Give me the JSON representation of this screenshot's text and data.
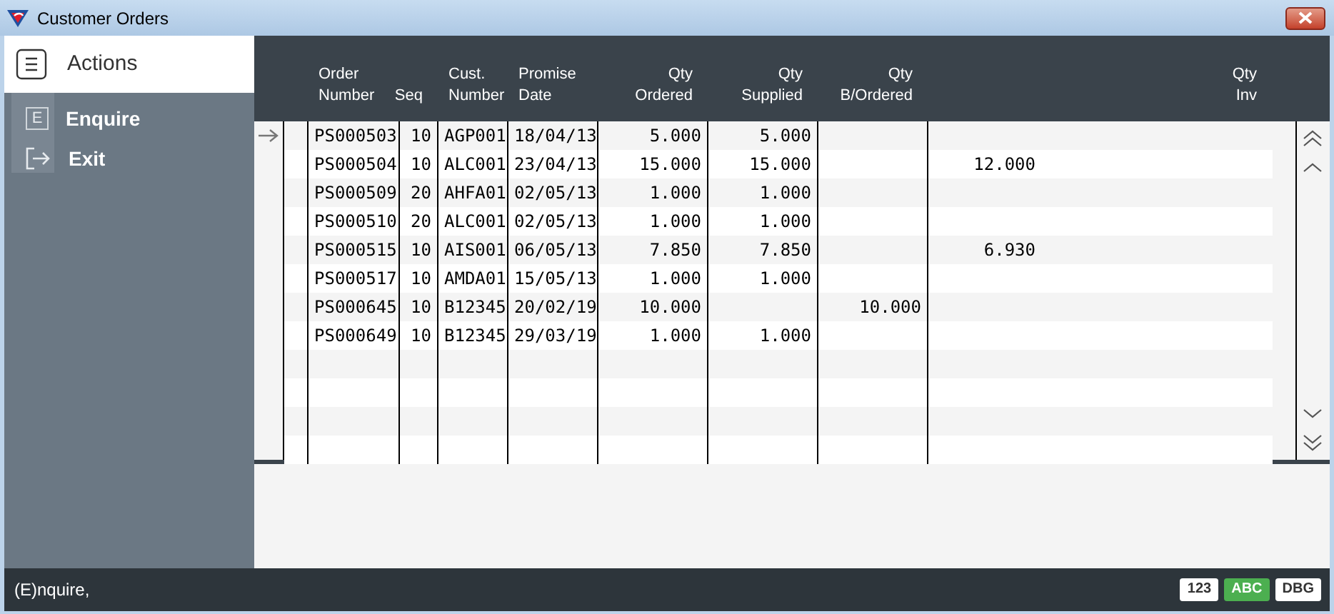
{
  "window": {
    "title": "Customer Orders"
  },
  "sidebar": {
    "title": "Actions",
    "items": [
      {
        "key": "E",
        "label": "Enquire",
        "kind": "key"
      },
      {
        "label": "Exit",
        "kind": "exit"
      }
    ]
  },
  "table": {
    "columns": [
      {
        "label": "Order\nNumber"
      },
      {
        "label": "Seq"
      },
      {
        "label": "Cust.\nNumber"
      },
      {
        "label": "Promise\nDate"
      },
      {
        "label": "Qty\nOrdered"
      },
      {
        "label": "Qty\nSupplied"
      },
      {
        "label": "Qty\nB/Ordered"
      },
      {
        "label": "Qty\nInv"
      }
    ],
    "rows": [
      {
        "current": true,
        "cells": [
          "PS000503",
          "10",
          "AGP001",
          "18/04/13",
          "5.000",
          "5.000",
          null,
          null
        ]
      },
      {
        "current": false,
        "cells": [
          "PS000504",
          "10",
          "ALC001",
          "23/04/13",
          "15.000",
          "15.000",
          null,
          "12.000"
        ]
      },
      {
        "current": false,
        "cells": [
          "PS000509",
          "20",
          "AHFA01",
          "02/05/13",
          "1.000",
          "1.000",
          null,
          null
        ]
      },
      {
        "current": false,
        "cells": [
          "PS000510",
          "20",
          "ALC001",
          "02/05/13",
          "1.000",
          "1.000",
          null,
          null
        ]
      },
      {
        "current": false,
        "cells": [
          "PS000515",
          "10",
          "AIS001",
          "06/05/13",
          "7.850",
          "7.850",
          null,
          "6.930"
        ]
      },
      {
        "current": false,
        "cells": [
          "PS000517",
          "10",
          "AMDA01",
          "15/05/13",
          "1.000",
          "1.000",
          null,
          null
        ]
      },
      {
        "current": false,
        "cells": [
          "PS000645",
          "10",
          "B12345",
          "20/02/19",
          "10.000",
          null,
          "10.000",
          null
        ]
      },
      {
        "current": false,
        "cells": [
          "PS000649",
          "10",
          "B12345",
          "29/03/19",
          "1.000",
          "1.000",
          null,
          null
        ]
      }
    ]
  },
  "status_bar": {
    "text": "(E)nquire,",
    "badges": [
      {
        "label": "123",
        "selected": false
      },
      {
        "label": "ABC",
        "selected": true
      },
      {
        "label": "DBG",
        "selected": false
      }
    ]
  }
}
